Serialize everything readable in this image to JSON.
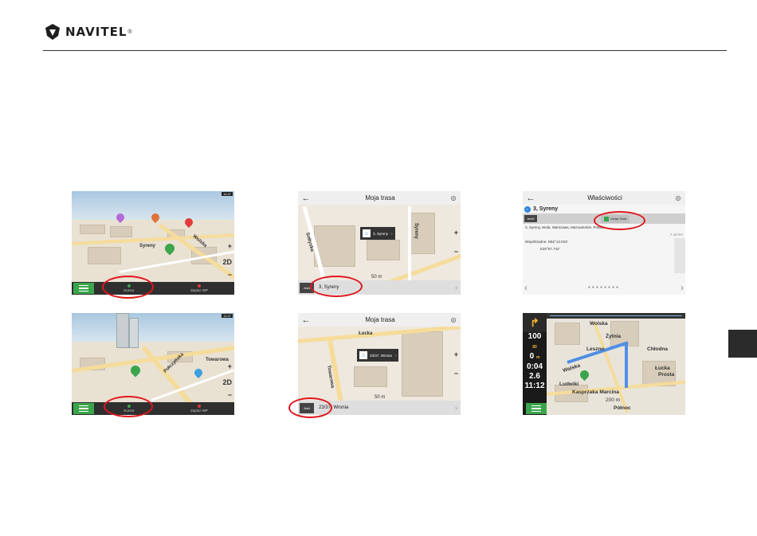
{
  "header": {
    "brand": "NAVITEL",
    "reg": "®"
  },
  "shots": {
    "s1": {
      "status": "11:47",
      "labels": [
        "Syreny",
        "Wolska"
      ],
      "bar": [
        "Kursor",
        "Zapisz WP"
      ]
    },
    "s2": {
      "title": "Moja trasa",
      "street": "Sołtyska",
      "street2": "Syreny",
      "popup": "3, Syreny",
      "scale": "50 m",
      "route": "3, Syreny",
      "flag": "Jedź"
    },
    "s3": {
      "title": "Właściwości",
      "name": "3, Syreny",
      "act": "Jedź!",
      "ustaw": "Ustaw Start",
      "address": "3, Syreny, Wola, Warszawa, Mazowieckie, Polska",
      "coords1": "Współrzędne: N52°14.019'",
      "coords2": "E20°57.742'",
      "dist": "7.18 km"
    },
    "s4": {
      "status": "11:47",
      "labels": [
        "Połczyńska",
        "Towarowa"
      ],
      "bar": [
        "Kursor",
        "Zapisz WP"
      ]
    },
    "s5": {
      "title": "Moja trasa",
      "street": "Łucka",
      "street2": "Towarowa",
      "popup": "23/37, Wronia",
      "scale": "50 m",
      "route": "23/37, Wronia",
      "flag": "Jedź"
    },
    "s6": {
      "speed": "100",
      "speed_unit": "m",
      "limit": "80",
      "dist_left": "0",
      "time_left": "0:04",
      "dist_total": "2.6",
      "arrival": "11:12",
      "streets": [
        "Wolska",
        "Żytnia",
        "Chłodna",
        "Leszno",
        "Wolska",
        "Ludwiki",
        "Kasprzaka Marcina",
        "Prosta",
        "Łucka",
        "Północ"
      ],
      "scale": "200 m"
    }
  }
}
